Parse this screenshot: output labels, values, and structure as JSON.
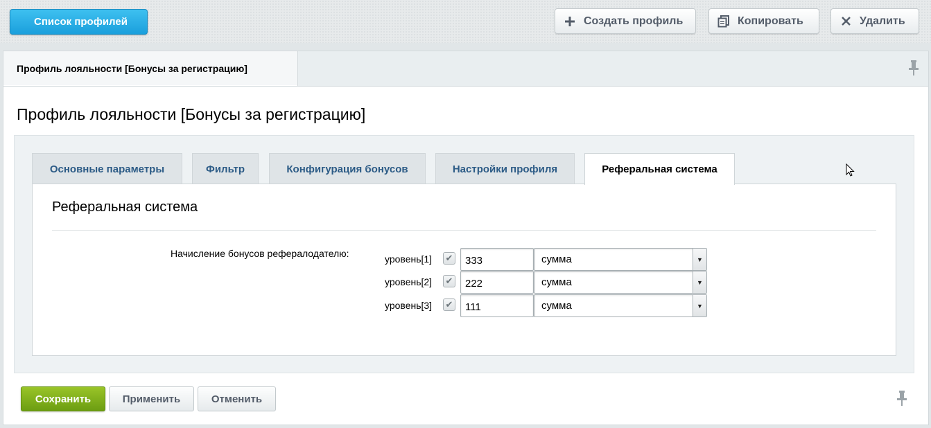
{
  "toolbar": {
    "back_label": "Список профилей",
    "create_label": "Создать профиль",
    "copy_label": "Копировать",
    "delete_label": "Удалить"
  },
  "header_tab": {
    "label": "Профиль лояльности [Бонусы за регистрацию]"
  },
  "page": {
    "title": "Профиль лояльности [Бонусы за регистрацию]"
  },
  "tabs": [
    {
      "label": "Основные параметры",
      "active": false
    },
    {
      "label": "Фильтр",
      "active": false
    },
    {
      "label": "Конфигурация бонусов",
      "active": false
    },
    {
      "label": "Настройки профиля",
      "active": false
    },
    {
      "label": "Реферальная система",
      "active": true
    }
  ],
  "section": {
    "title": "Реферальная система",
    "field_label": "Начисление бонусов рефералодателю:",
    "levels": [
      {
        "label": "уровень[1]",
        "checked": true,
        "value": "333",
        "type": "сумма"
      },
      {
        "label": "уровень[2]",
        "checked": true,
        "value": "222",
        "type": "сумма"
      },
      {
        "label": "уровень[3]",
        "checked": true,
        "value": "111",
        "type": "сумма"
      }
    ]
  },
  "footer": {
    "save_label": "Сохранить",
    "apply_label": "Применить",
    "cancel_label": "Отменить"
  },
  "icons": {
    "create": "plus-icon",
    "copy": "copy-icon",
    "delete": "close-icon",
    "pin": "pin-icon",
    "dropdown": "chevron-down-icon",
    "checkbox": "checkmark-icon"
  },
  "colors": {
    "back_button": "#1a9fdc",
    "save_button": "#7fae1a",
    "tab_text": "#2c5b86",
    "button_text": "#535c69"
  }
}
